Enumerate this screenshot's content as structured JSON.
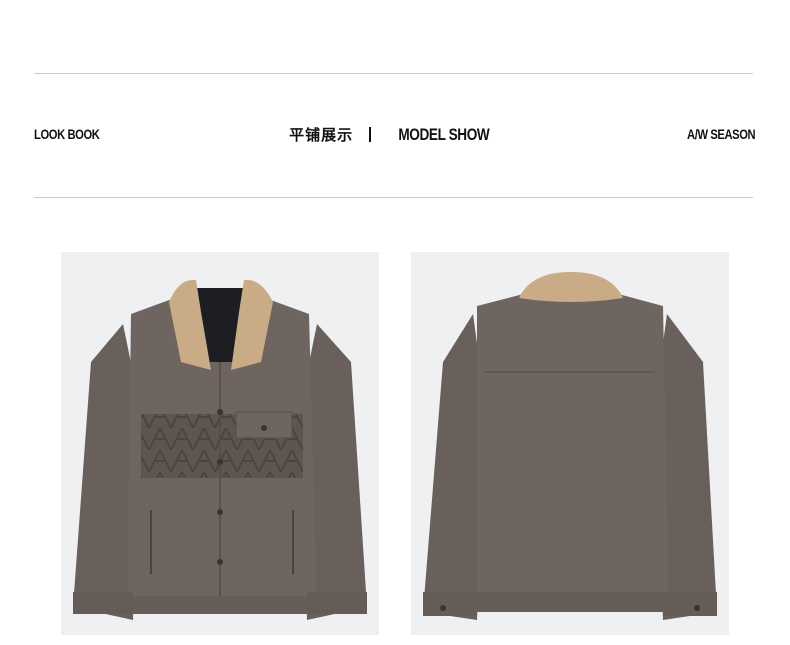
{
  "header": {
    "left_label": "LOOK BOOK",
    "center_cn": "平铺展示",
    "center_en": "MODEL SHOW",
    "right_label": "A/W SEASON"
  },
  "photos": [
    {
      "view": "front",
      "subject": "jacket-front"
    },
    {
      "view": "back",
      "subject": "jacket-back"
    }
  ],
  "colors": {
    "jacket": "#6f6560",
    "collar": "#c9ab86",
    "photo_bg": "#eef0f2",
    "rule": "#c9c9c9"
  }
}
